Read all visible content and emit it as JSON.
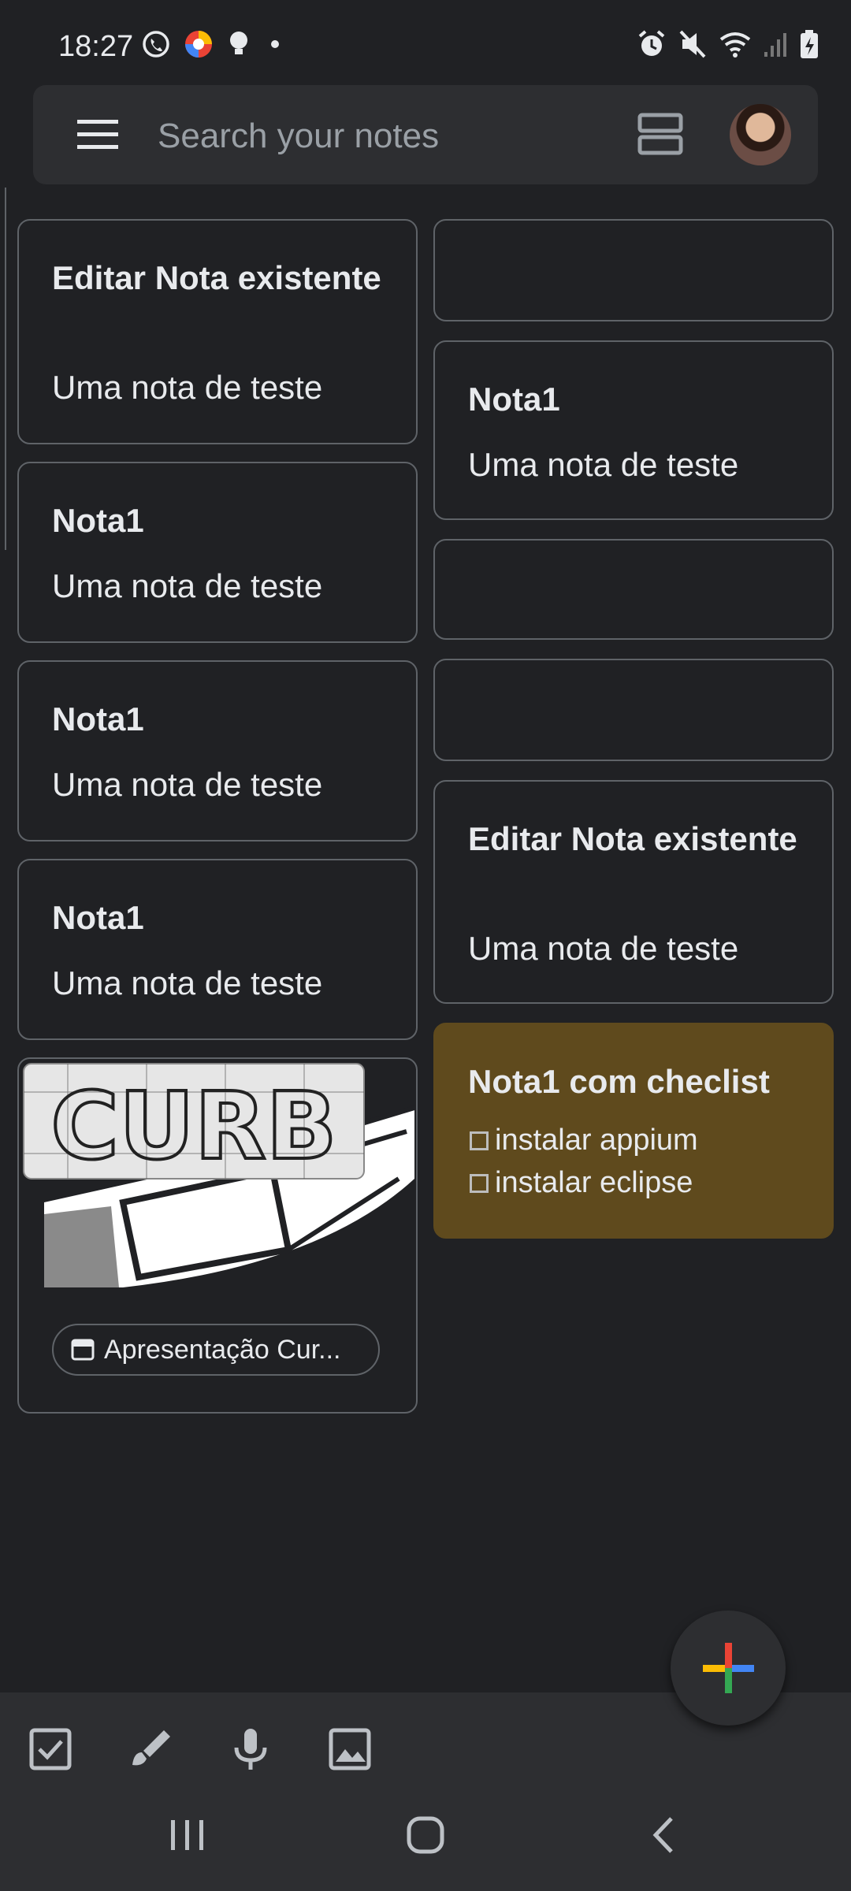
{
  "status_bar": {
    "time": "18:27"
  },
  "search": {
    "placeholder": "Search your notes"
  },
  "notes_left": [
    {
      "title": "Editar Nota existente",
      "body": "Uma nota de teste"
    },
    {
      "title": "Nota1",
      "body": "Uma nota de teste"
    },
    {
      "title": "Nota1",
      "body": "Uma nota de teste"
    },
    {
      "title": "Nota1",
      "body": "Uma nota de teste"
    }
  ],
  "notes_right": [
    {
      "title": "Nota1",
      "body": "Uma nota de teste"
    },
    {
      "title": "Editar Nota existente",
      "body": "Uma nota de teste"
    }
  ],
  "image_note": {
    "logo_text": "CURB",
    "chip_label": "Apresentação Cur..."
  },
  "checklist_note": {
    "title": "Nota1 com checlist",
    "items": [
      "instalar appium",
      "instalar eclipse"
    ],
    "color": "#5f4a1d"
  },
  "colors": {
    "background": "#202124",
    "surface": "#2d2e31",
    "border": "#5f6368"
  }
}
